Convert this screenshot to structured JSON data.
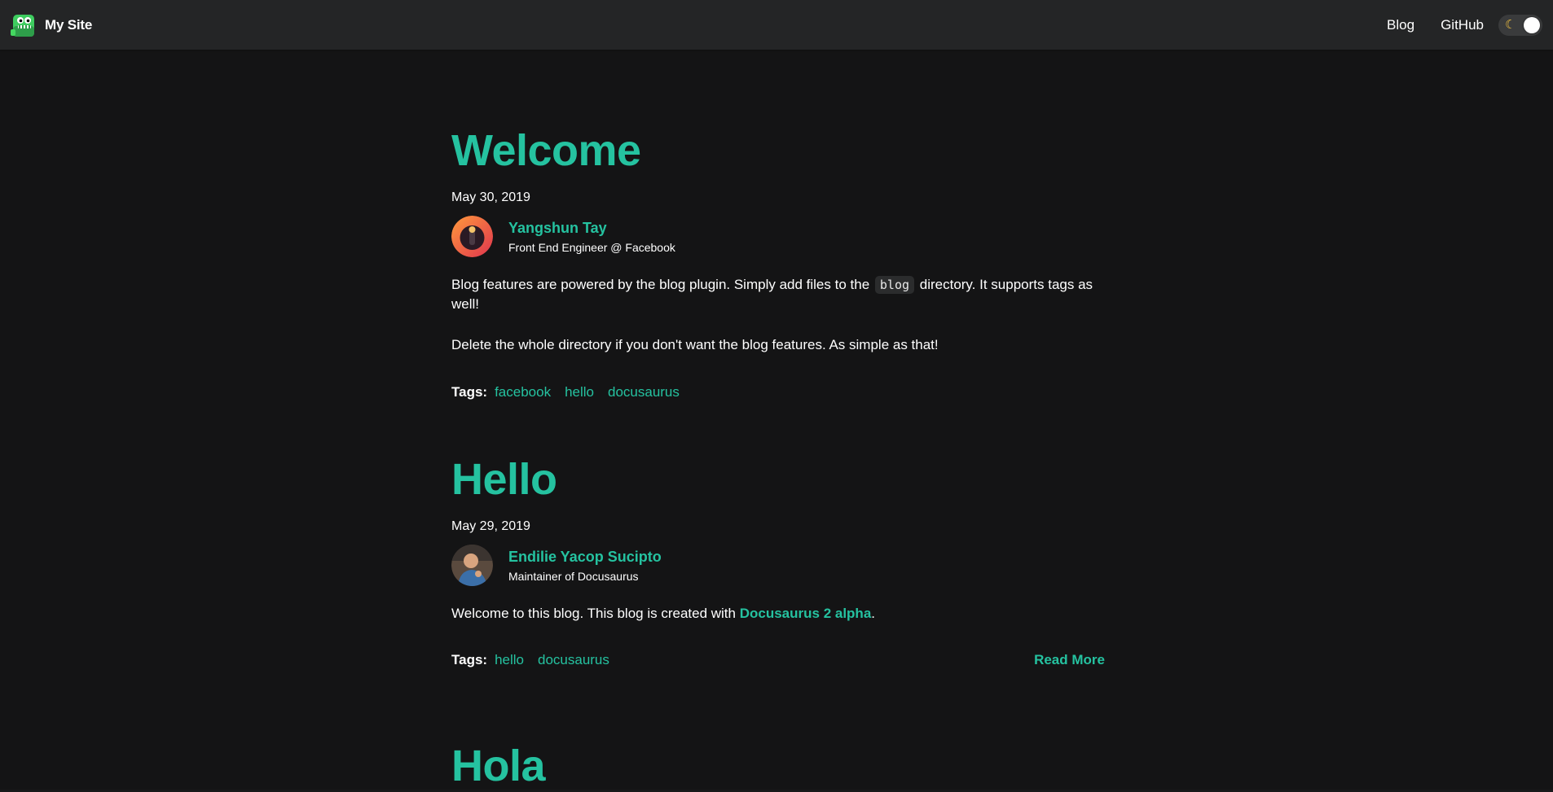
{
  "navbar": {
    "site_title": "My Site",
    "links": [
      {
        "label": "Blog"
      },
      {
        "label": "GitHub"
      }
    ],
    "theme_toggle": {
      "icon": "moon-icon",
      "state": "dark"
    }
  },
  "colors": {
    "accent": "#25c2a0",
    "navbar_bg": "#242526",
    "page_bg": "#141415"
  },
  "posts": [
    {
      "title": "Welcome",
      "date": "May 30, 2019",
      "author": {
        "name": "Yangshun Tay",
        "title": "Front End Engineer @ Facebook"
      },
      "body": {
        "p1_before": "Blog features are powered by the blog plugin. Simply add files to the",
        "p1_code": "blog",
        "p1_after": "directory. It supports tags as well!",
        "p2": "Delete the whole directory if you don't want the blog features. As simple as that!"
      },
      "tags_label": "Tags:",
      "tags": [
        "facebook",
        "hello",
        "docusaurus"
      ]
    },
    {
      "title": "Hello",
      "date": "May 29, 2019",
      "author": {
        "name": "Endilie Yacop Sucipto",
        "title": "Maintainer of Docusaurus"
      },
      "body": {
        "p1_before": "Welcome to this blog. This blog is created with",
        "p1_link": "Docusaurus 2 alpha",
        "p1_after": "."
      },
      "tags_label": "Tags:",
      "tags": [
        "hello",
        "docusaurus"
      ],
      "read_more": "Read More"
    },
    {
      "title": "Hola"
    }
  ]
}
